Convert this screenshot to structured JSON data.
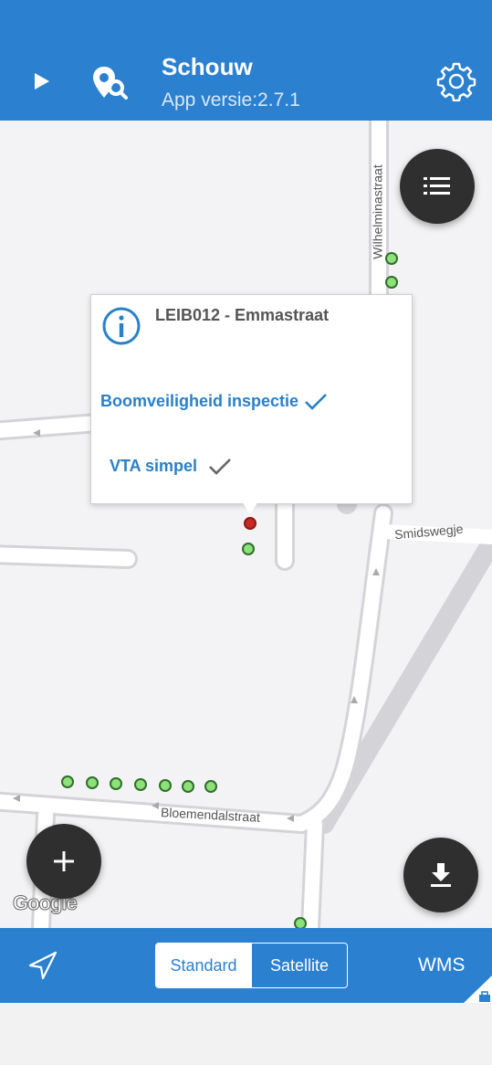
{
  "header": {
    "title": "Schouw",
    "subtitle": "App versie:2.7.1",
    "play_icon": "play-icon",
    "pin_icon": "location-search-icon",
    "settings_icon": "gear-icon"
  },
  "map": {
    "streets": {
      "wilhelmina": "Wilhelminastraat",
      "smidswegje": "Smidswegje",
      "bloemendal": "Bloemendalstraat"
    },
    "popup": {
      "title": "LEIB012 - Emmastraat",
      "item1": "Boomveiligheid inspectie",
      "item2": "VTA simpel"
    },
    "google_logo": "Google",
    "list_button_icon": "list-icon",
    "add_button_icon": "plus-icon",
    "download_button_icon": "download-icon"
  },
  "bottombar": {
    "nav_icon": "navigation-arrow-icon",
    "map_types": [
      "Standard",
      "Satellite"
    ],
    "selected": "Standard",
    "wms_label": "WMS"
  },
  "colors": {
    "primary": "#2b80cf",
    "marker_green": "#8ee07a",
    "marker_red": "#c72a25",
    "fab": "#2f2f2f"
  }
}
